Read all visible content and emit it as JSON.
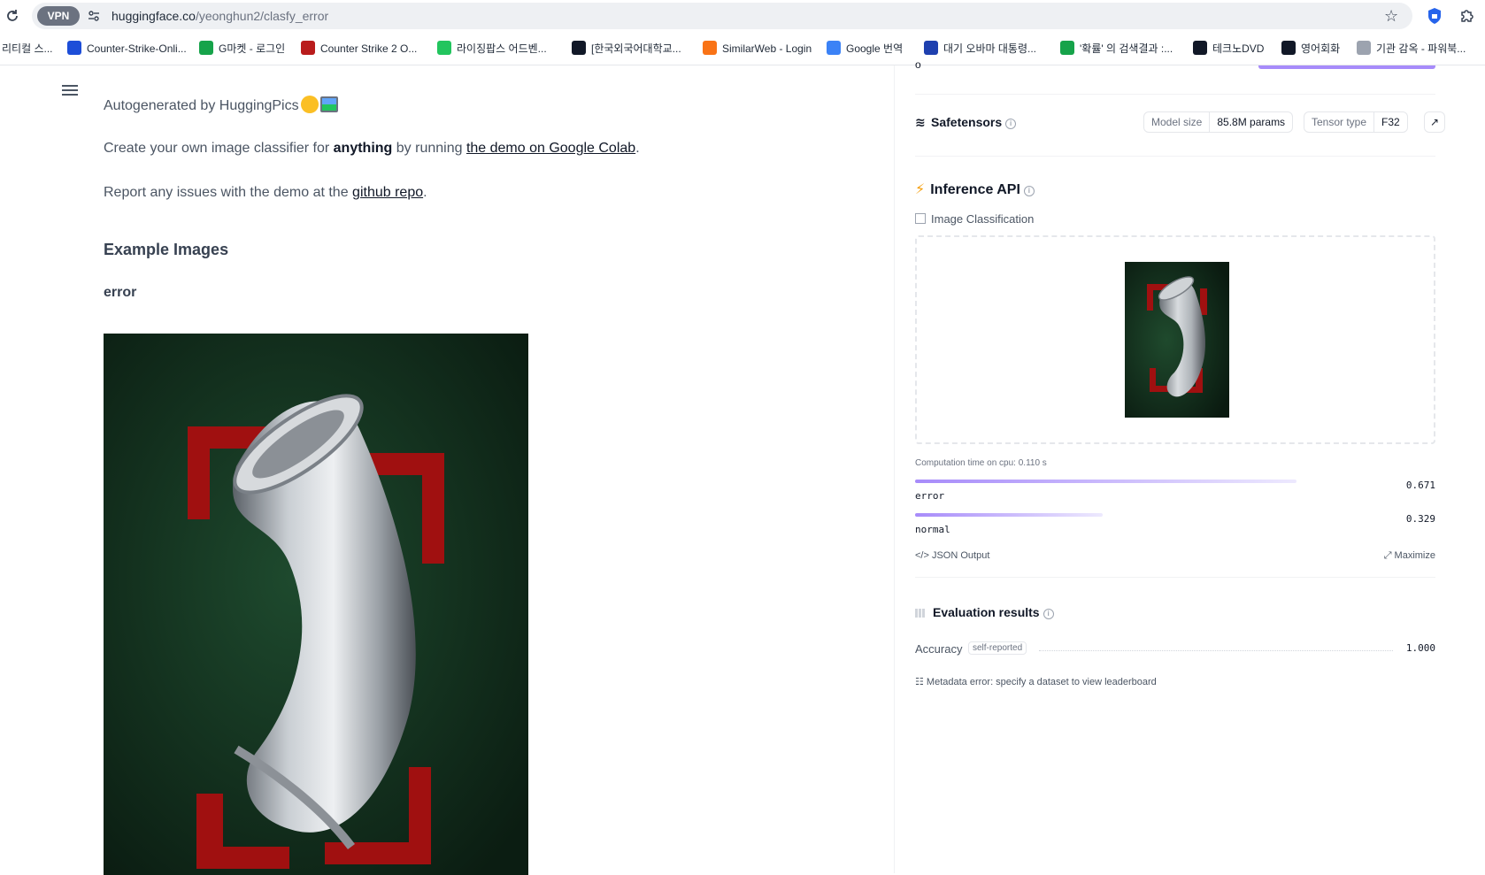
{
  "browser": {
    "vpn_badge": "VPN",
    "url_host": "huggingface.co",
    "url_path": "/yeonghun2/clasfy_error"
  },
  "bookmarks": [
    {
      "label": "리티컬 스...",
      "color": "#ffffff"
    },
    {
      "label": "Counter-Strike-Onli...",
      "color": "#1d4ed8"
    },
    {
      "label": "G마켓 - 로그인",
      "color": "#16a34a"
    },
    {
      "label": "Counter Strike 2 O...",
      "color": "#b91c1c"
    },
    {
      "label": "라이징팝스 어드벤...",
      "color": "#22c55e"
    },
    {
      "label": "[한국외국어대학교...",
      "color": "#111827"
    },
    {
      "label": "SimilarWeb - Login",
      "color": "#f97316"
    },
    {
      "label": "Google 번역",
      "color": "#3b82f6"
    },
    {
      "label": "대기 오바마 대통령...",
      "color": "#1e40af"
    },
    {
      "label": "'확률' 의 검색결과 :...",
      "color": "#16a34a"
    },
    {
      "label": "테크노DVD",
      "color": "#111827"
    },
    {
      "label": "영어회화",
      "color": "#111827"
    },
    {
      "label": "기관 감옥 - 파워북...",
      "color": "#9ca3af"
    }
  ],
  "content": {
    "autogen_text": "Autogenerated by HuggingPics",
    "create_prefix": "Create your own image classifier for ",
    "create_bold": "anything",
    "create_mid": " by running ",
    "create_link": "the demo on Google Colab",
    "create_suffix": ".",
    "report_prefix": "Report any issues with the demo at the ",
    "report_link": "github repo",
    "report_suffix": ".",
    "example_heading": "Example Images",
    "example_label": "error"
  },
  "sidebar": {
    "safetensors_label": "Safetensors",
    "model_size_key": "Model size",
    "model_size_val": "85.8M params",
    "tensor_type_key": "Tensor type",
    "tensor_type_val": "F32",
    "arrow": "↗",
    "inference_title": "Inference API",
    "task_label": "Image Classification",
    "computation_time": "Computation time on cpu: 0.110 s",
    "results": [
      {
        "label": "error",
        "score": "0.671",
        "value": 0.671
      },
      {
        "label": "normal",
        "score": "0.329",
        "value": 0.329
      }
    ],
    "json_output": "JSON Output",
    "maximize": "Maximize",
    "eval_title": "Evaluation results",
    "accuracy_label": "Accuracy",
    "self_reported": "self-reported",
    "accuracy_value": "1.000",
    "metadata_error": "Metadata error: specify a dataset to view leaderboard"
  }
}
